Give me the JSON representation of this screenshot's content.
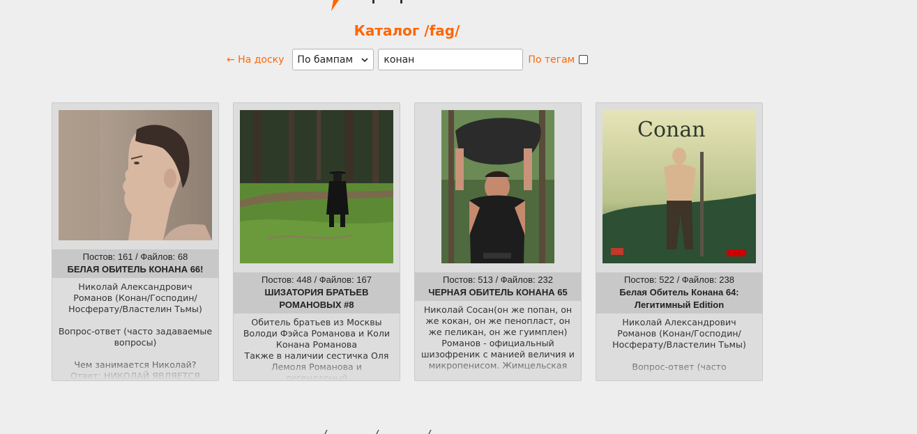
{
  "page": {
    "title": "Каталог /fag/"
  },
  "controls": {
    "back_link": "← На доску",
    "sort_select_value": "По бампам",
    "search_value": "конан",
    "tags_label": "По тегам",
    "tags_checked": false
  },
  "colors": {
    "accent": "#ff6600",
    "background": "#eeeeee",
    "card": "#dddddd",
    "card_meta": "#c8c8c8"
  },
  "cards": [
    {
      "stats": "Постов: 161 / Файлов: 68",
      "subject": "БЕЛАЯ ОБИТЕЛЬ КОНАНА 66!",
      "comment": "Николай Александрович Романов (Конан/Господин/ Носферату/Властелин Тьмы)\n\nВопрос-ответ (часто задаваемые вопросы)\n\nЧем занимается Николай?\nОтвет: НИКОЛАЙ ЯВЛЯЕТСЯ",
      "image": "woman-profile-photo"
    },
    {
      "stats": "Постов: 448 / Файлов: 167",
      "subject": "ШИЗАТОРИЯ БРАТЬЕВ РОМАНОВЫХ #8",
      "comment": "Обитель братьев из Москвы Володи Фэйса Романова и Коли Конана Романова\nТакже в наличии сестичка Оля Лемоля Романова и легендарный",
      "image": "forest-figure-photo"
    },
    {
      "stats": "Постов: 513 / Файлов: 232",
      "subject": "ЧЕРНАЯ ОБИТЕЛЬ КОНАНА 65",
      "comment": "Николай Сосан(он же попан, он же кокан, он же пенопласт, он же пеликан, он же гуимплен) Романов - официальный шизофреник с манией величия и микропенисом. Жимцельская",
      "image": "man-lifting-rock-photo"
    },
    {
      "stats": "Постов: 522 / Файлов: 238",
      "subject": "Белая Обитель Конана 64: Легитимный Edition",
      "comment": "Николай Александрович Романов (Конан/Господин/ Носферату/Властелин Тьмы)\n\nВопрос-ответ (часто",
      "image": "conan-poster-art",
      "poster_text": "Conan"
    }
  ]
}
